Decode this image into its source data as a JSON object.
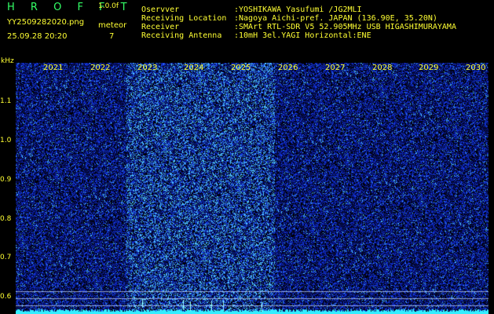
{
  "header": {
    "logo": "H R O F F T",
    "version": "1.0.0f",
    "filename": "YY2509282020.png",
    "meteor_label": "meteor",
    "datetime": "25.09.28 20:20",
    "meteor_count": "7"
  },
  "info": {
    "labels": [
      "Oservver",
      "Receiving Location",
      "Receiver",
      "Receiving Antenna"
    ],
    "values": [
      ":YOSHIKAWA Yasufumi /JG2MLI",
      ":Nagoya Aichi-pref. JAPAN (136.90E, 35.20N)",
      ":SMArt RTL-SDR V5 52.905MHz USB HIGASHIMURAYAMA",
      ":10mH 3el.YAGI Horizontal:ENE"
    ]
  },
  "axis": {
    "unit": "kHz",
    "y_labels": [
      "1.1",
      "1.0",
      "0.9",
      "0.8",
      "0.7",
      "0.6"
    ],
    "x_labels": [
      "2021",
      "2022",
      "2023",
      "2024",
      "2025",
      "2026",
      "2027",
      "2028",
      "2029",
      "2030"
    ]
  },
  "colors": {
    "text": "#ffff33",
    "logo": "#33ff66",
    "background": "#000000",
    "noise": "#1a2fd0",
    "bright": "#33ccff"
  }
}
